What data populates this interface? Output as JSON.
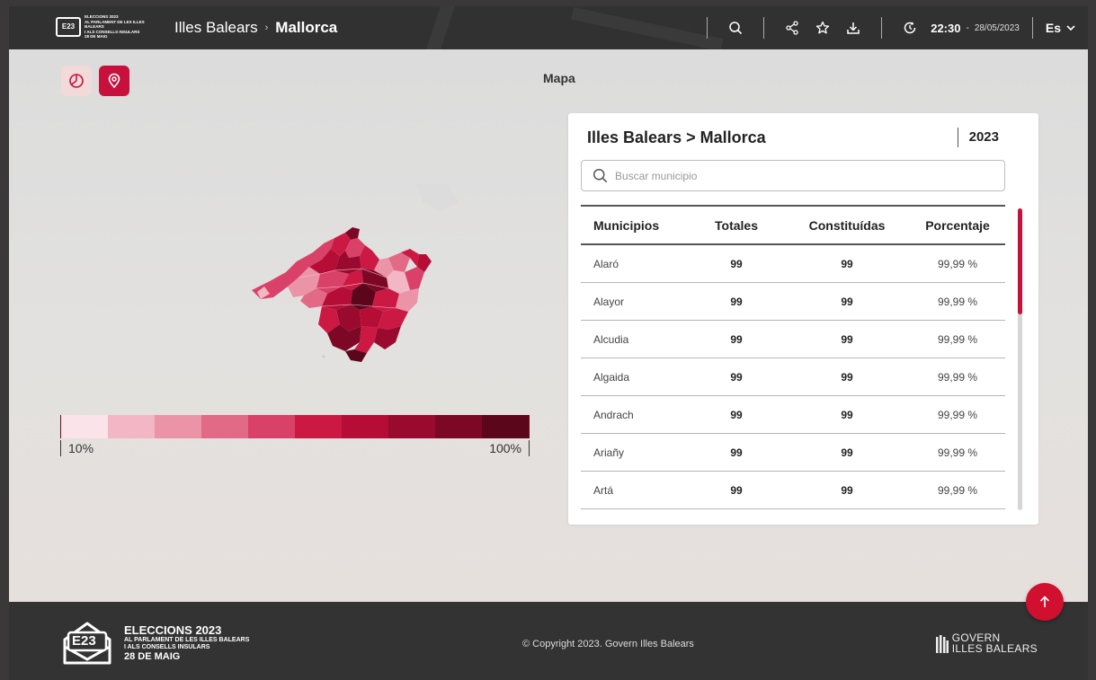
{
  "header": {
    "logo_title": "ELECCIONS 2023",
    "logo_line1": "AL PARLAMENT DE LES ILLES BALEARS",
    "logo_line2": "I ALS CONSELLS INSULARS",
    "logo_line3": "28 DE MAIG",
    "logo_mark": "E23",
    "breadcrumb_root": "Illes Balears",
    "breadcrumb_current": "Mallorca",
    "time": "22:30",
    "date_sep": "-",
    "date": "28/05/2023",
    "language": "Es",
    "icons": [
      "search-icon",
      "share-icon",
      "star-icon",
      "download-icon",
      "clock-icon",
      "chevron-down-icon"
    ]
  },
  "main": {
    "title": "Mapa",
    "toggles": [
      "pie-chart-icon",
      "map-pin-icon"
    ],
    "legend": {
      "min_label": "10%",
      "max_label": "100%",
      "colors": [
        "#fbe3ea",
        "#f2b6c4",
        "#eb94a8",
        "#e26a86",
        "#d94168",
        "#cc1944",
        "#b60d37",
        "#9a0a2f",
        "#7c0826",
        "#5c061c"
      ]
    }
  },
  "panel": {
    "title": "Illes Balears > Mallorca",
    "year": "2023",
    "search_placeholder": "Buscar municipio",
    "columns": [
      "Municipios",
      "Totales",
      "Constituídas",
      "Porcentaje"
    ],
    "rows": [
      {
        "municipio": "Alaró",
        "totales": "99",
        "constituidas": "99",
        "porcentaje": "99,99 %"
      },
      {
        "municipio": "Alayor",
        "totales": "99",
        "constituidas": "99",
        "porcentaje": "99,99 %"
      },
      {
        "municipio": "Alcudia",
        "totales": "99",
        "constituidas": "99",
        "porcentaje": "99,99 %"
      },
      {
        "municipio": "Algaida",
        "totales": "99",
        "constituidas": "99",
        "porcentaje": "99,99 %"
      },
      {
        "municipio": "Andrach",
        "totales": "99",
        "constituidas": "99",
        "porcentaje": "99,99 %"
      },
      {
        "municipio": "Ariañy",
        "totales": "99",
        "constituidas": "99",
        "porcentaje": "99,99 %"
      },
      {
        "municipio": "Artá",
        "totales": "99",
        "constituidas": "99",
        "porcentaje": "99,99 %"
      }
    ]
  },
  "footer": {
    "title": "ELECCIONS 2023",
    "line1": "AL PARLAMENT DE LES ILLES BALEARS",
    "line2": "I ALS CONSELLS INSULARS",
    "line3": "28 DE MAIG",
    "mark": "E23",
    "copyright": "© Copyright 2023. Govern Illes Balears",
    "govern_line1": "GOVERN",
    "govern_line2": "ILLES BALEARS"
  },
  "colors": {
    "accent": "#c8103c",
    "header_bg": "#323132",
    "footer_bg": "#343334"
  }
}
